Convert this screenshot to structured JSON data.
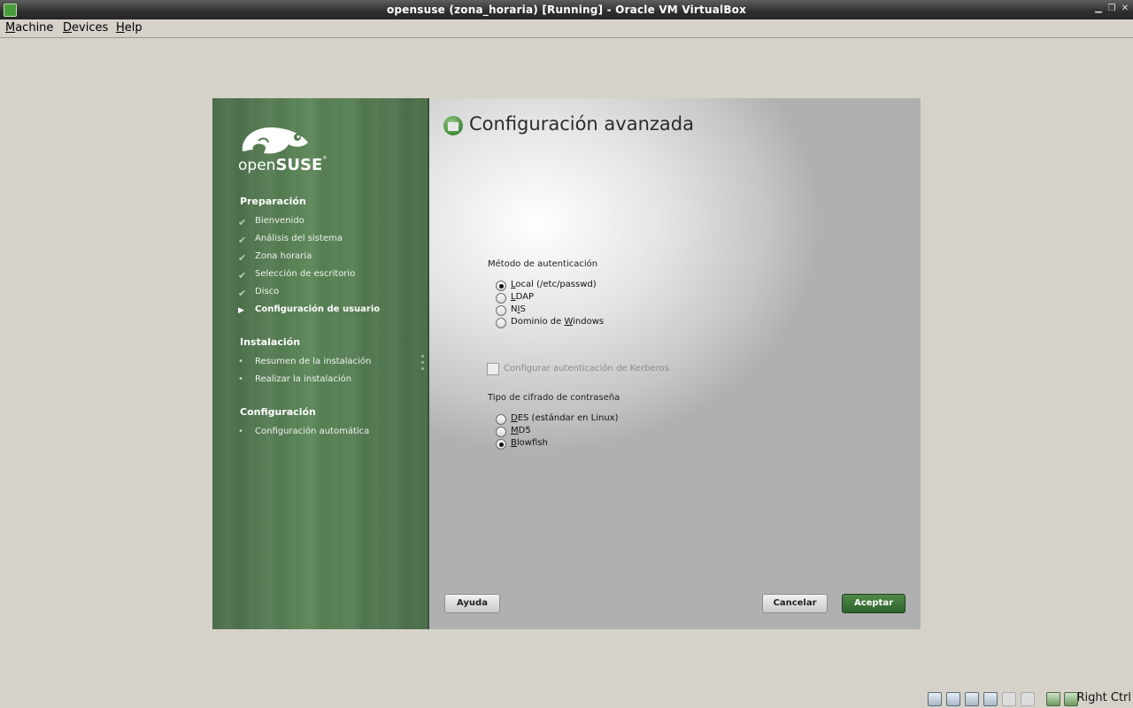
{
  "window": {
    "title": "opensuse (zona_horaria) [Running] - Oracle VM VirtualBox",
    "controls": [
      "minimize",
      "restore",
      "close"
    ]
  },
  "menubar": {
    "items": [
      "Machine",
      "Devices",
      "Help"
    ]
  },
  "sidebar": {
    "logo_text": "openSUSE",
    "sections": [
      {
        "title": "Preparación",
        "steps": [
          {
            "label": "Bienvenido",
            "state": "done"
          },
          {
            "label": "Análisis del sistema",
            "state": "done"
          },
          {
            "label": "Zona horaria",
            "state": "done"
          },
          {
            "label": "Selección de escritorio",
            "state": "done"
          },
          {
            "label": "Disco",
            "state": "done"
          },
          {
            "label": "Configuración de usuario",
            "state": "current"
          }
        ]
      },
      {
        "title": "Instalación",
        "steps": [
          {
            "label": "Resumen de la instalación",
            "state": "pending"
          },
          {
            "label": "Realizar la instalación",
            "state": "pending"
          }
        ]
      },
      {
        "title": "Configuración",
        "steps": [
          {
            "label": "Configuración automática",
            "state": "pending"
          }
        ]
      }
    ]
  },
  "main": {
    "title": "Configuración avanzada",
    "auth": {
      "label": "Método de autenticación",
      "options": [
        {
          "before": "",
          "mn": "L",
          "after": "ocal (/etc/passwd)",
          "checked": true
        },
        {
          "before": "",
          "mn": "L",
          "after": "DAP",
          "checked": false
        },
        {
          "before": "N",
          "mn": "I",
          "after": "S",
          "checked": false
        },
        {
          "before": "Dominio de ",
          "mn": "W",
          "after": "indows",
          "checked": false
        }
      ]
    },
    "kerberos": {
      "label": "Configurar autenticación de Kerberos",
      "checked": false,
      "enabled": false
    },
    "encryption": {
      "label": "Tipo de cifrado de contraseña",
      "options": [
        {
          "before": "",
          "mn": "D",
          "after": "ES (estándar en Linux)",
          "checked": false
        },
        {
          "before": "",
          "mn": "M",
          "after": "D5",
          "checked": false
        },
        {
          "before": "",
          "mn": "B",
          "after": "lowfish",
          "checked": true
        }
      ]
    },
    "buttons": {
      "help": "Ayuda",
      "cancel": "Cancelar",
      "accept": "Aceptar"
    }
  },
  "tray": {
    "host_key": "Right Ctrl"
  },
  "colors": {
    "sidebar_green": "#5b8557",
    "accept_green": "#2f622d",
    "host_bg": "#d6d2ca"
  }
}
